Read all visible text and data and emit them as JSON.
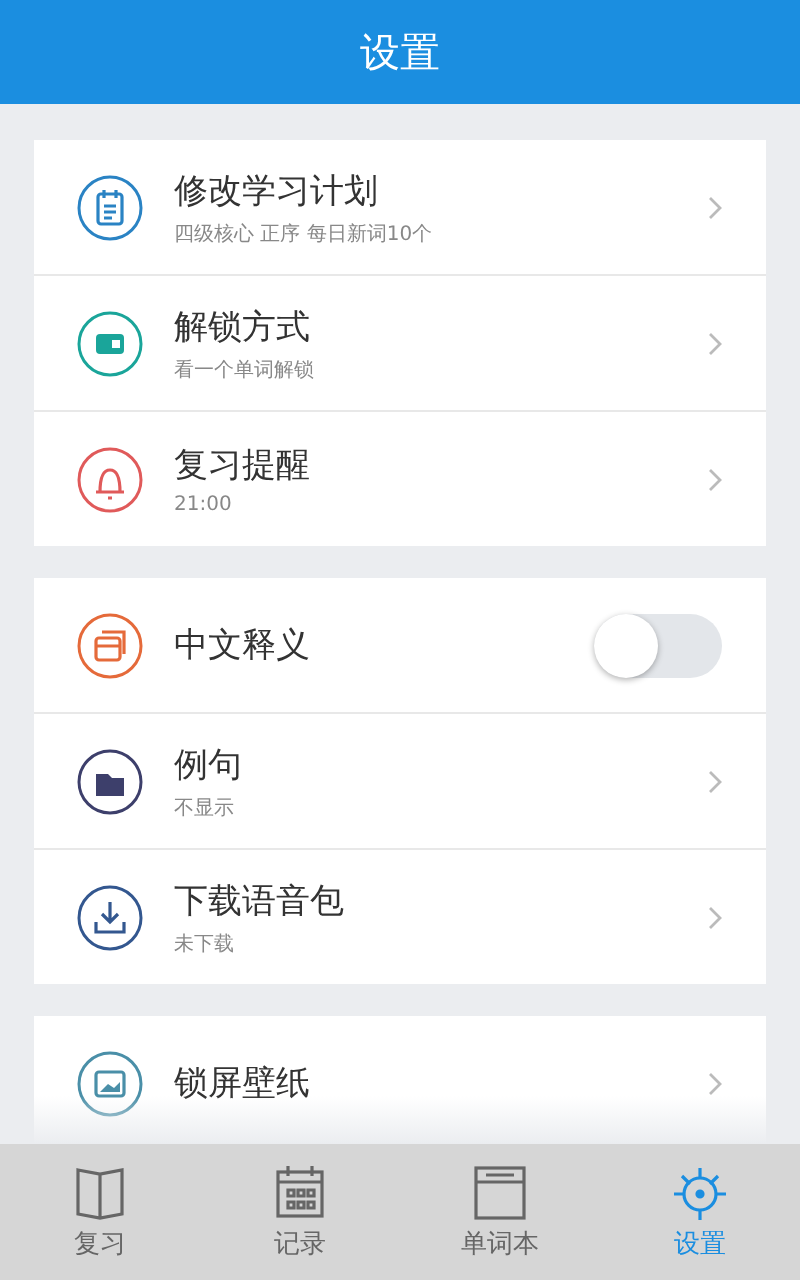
{
  "header": {
    "title": "设置"
  },
  "groups": [
    {
      "items": [
        {
          "kind": "link",
          "title": "修改学习计划",
          "subtitle": "四级核心 正序 每日新词10个"
        },
        {
          "kind": "link",
          "title": "解锁方式",
          "subtitle": "看一个单词解锁"
        },
        {
          "kind": "link",
          "title": "复习提醒",
          "subtitle": "21:00"
        }
      ]
    },
    {
      "items": [
        {
          "kind": "toggle",
          "title": "中文释义",
          "on": false
        },
        {
          "kind": "link",
          "title": "例句",
          "subtitle": "不显示"
        },
        {
          "kind": "link",
          "title": "下载语音包",
          "subtitle": "未下载"
        }
      ]
    },
    {
      "items": [
        {
          "kind": "link",
          "title": "锁屏壁纸"
        }
      ]
    }
  ],
  "tabs": [
    {
      "label": "复习",
      "selected": false
    },
    {
      "label": "记录",
      "selected": false
    },
    {
      "label": "单词本",
      "selected": false
    },
    {
      "label": "设置",
      "selected": true
    }
  ]
}
